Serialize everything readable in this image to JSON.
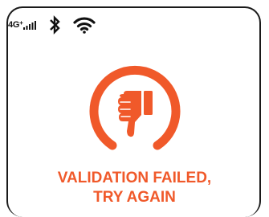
{
  "status_bar": {
    "network_label": "4G",
    "network_plus": "+",
    "signal_icon": "signal-bars-icon",
    "bluetooth_icon": "bluetooth-icon",
    "wifi_icon": "wifi-icon"
  },
  "result": {
    "icon": "thumbs-down-icon",
    "message_line1": "VALIDATION FAILED,",
    "message_line2": "TRY AGAIN"
  },
  "colors": {
    "accent": "#f0592a",
    "icon_dark": "#111111"
  }
}
